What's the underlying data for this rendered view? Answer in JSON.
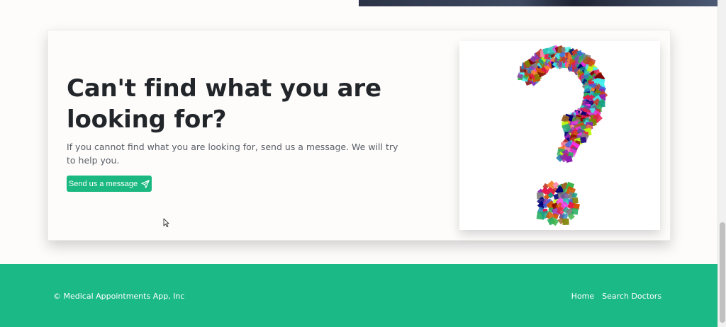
{
  "cta": {
    "title": "Can't find what you are looking for?",
    "description": "If you cannot find what you are looking for, send us a message. We will try to help you.",
    "button_label": "Send us a message",
    "button_icon": "send-icon",
    "image_description": "question-mark-mosaic",
    "accent_color": "#1bb981"
  },
  "footer": {
    "copyright": "© Medical Appointments App, Inc",
    "links": [
      {
        "label": "Home"
      },
      {
        "label": "Search Doctors"
      }
    ],
    "background_color": "#1bb985"
  }
}
